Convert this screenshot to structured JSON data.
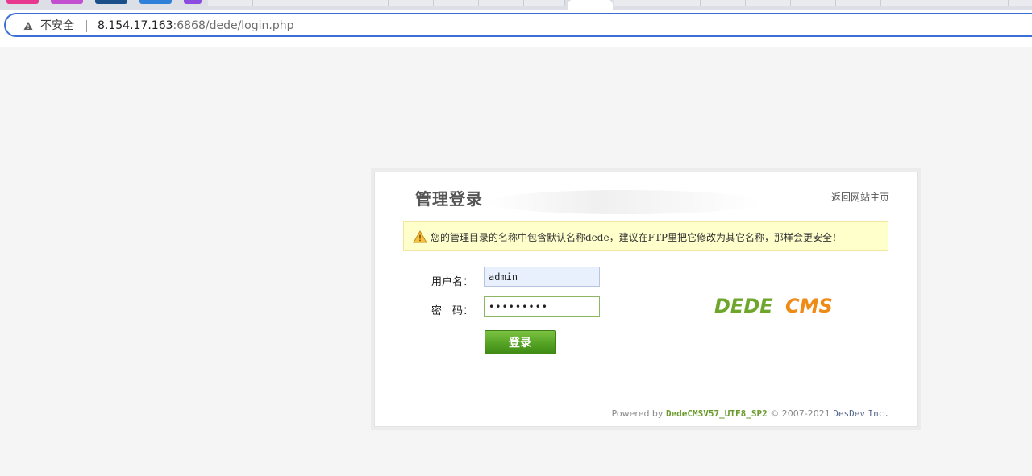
{
  "browser": {
    "security_label": "不安全",
    "url_host": "8.154.17.163",
    "url_rest": ":6868/dede/login.php"
  },
  "tabs": [
    {
      "color": "#e8378f"
    },
    {
      "color": "#c34fd0"
    },
    {
      "color": "#1b4f8a"
    },
    {
      "color": "#2f80d8"
    },
    {
      "color": "#8a4de0"
    }
  ],
  "login": {
    "title": "管理登录",
    "home_link": "返回网站主页",
    "notice": "您的管理目录的名称中包含默认名称dede，建议在FTP里把它修改为其它名称，那样会更安全！",
    "username_label": "用户名：",
    "password_label": "密　码：",
    "username_value": "admin",
    "password_value": "•••••••••",
    "submit_label": "登录",
    "logo_text_left": "DEDE",
    "logo_text_right": "CMS"
  },
  "footer": {
    "powered_by": "Powered by",
    "version": "DedeCMSV57_UTF8_SP2",
    "copyright": "© 2007-2021",
    "company": "DesDev",
    "inc": "Inc."
  },
  "colors": {
    "omnibox_border": "#3b6fd6",
    "notice_bg": "#ffffcc",
    "button_green": "#55a324",
    "logo_green": "#6ea62c",
    "logo_orange": "#f08a16"
  }
}
